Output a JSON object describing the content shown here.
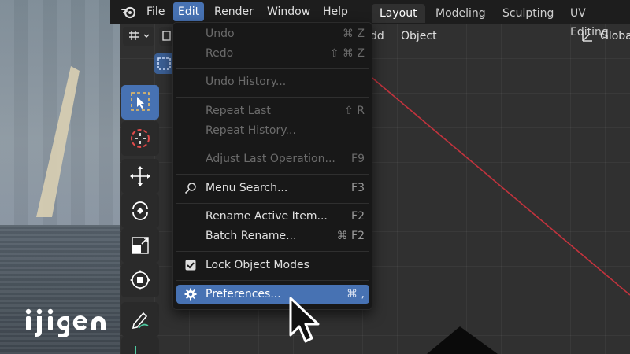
{
  "app_menu": {
    "items": [
      "File",
      "Edit",
      "Render",
      "Window",
      "Help"
    ],
    "active": "Edit"
  },
  "workspaces": {
    "tabs": [
      "Layout",
      "Modeling",
      "Sculpting",
      "UV Editing"
    ],
    "active": "Layout"
  },
  "viewport_header": {
    "add_label": "Add",
    "add_visible": "dd",
    "object_label": "Object",
    "orientation_label": "Global",
    "orientation_visible": "Globa"
  },
  "edit_menu": {
    "items": [
      {
        "label": "Undo",
        "shortcut": "⌘ Z",
        "enabled": false
      },
      {
        "label": "Redo",
        "shortcut": "⇧ ⌘ Z",
        "enabled": false
      },
      {
        "label": "Undo History...",
        "shortcut": "",
        "enabled": false
      },
      {
        "label": "Repeat Last",
        "shortcut": "⇧ R",
        "enabled": false
      },
      {
        "label": "Repeat History...",
        "shortcut": "",
        "enabled": false
      },
      {
        "label": "Adjust Last Operation...",
        "shortcut": "F9",
        "enabled": false
      },
      {
        "label": "Menu Search...",
        "shortcut": "F3",
        "enabled": true,
        "icon": "search-icon"
      },
      {
        "label": "Rename Active Item...",
        "shortcut": "F2",
        "enabled": true
      },
      {
        "label": "Batch Rename...",
        "shortcut": "⌘ F2",
        "enabled": true
      },
      {
        "label": "Lock Object Modes",
        "shortcut": "",
        "enabled": true,
        "icon": "checkbox-checked-icon",
        "checked": true
      },
      {
        "label": "Preferences...",
        "shortcut": "⌘ ,",
        "enabled": true,
        "icon": "gear-icon",
        "highlighted": true
      }
    ]
  },
  "watermark": {
    "text": "ijigen"
  },
  "colors": {
    "accent": "#4772b3",
    "menu_bg": "#181818",
    "topbar_bg": "#1d1d1d",
    "viewport_bg": "#303030",
    "x_axis": "#c2333d"
  }
}
